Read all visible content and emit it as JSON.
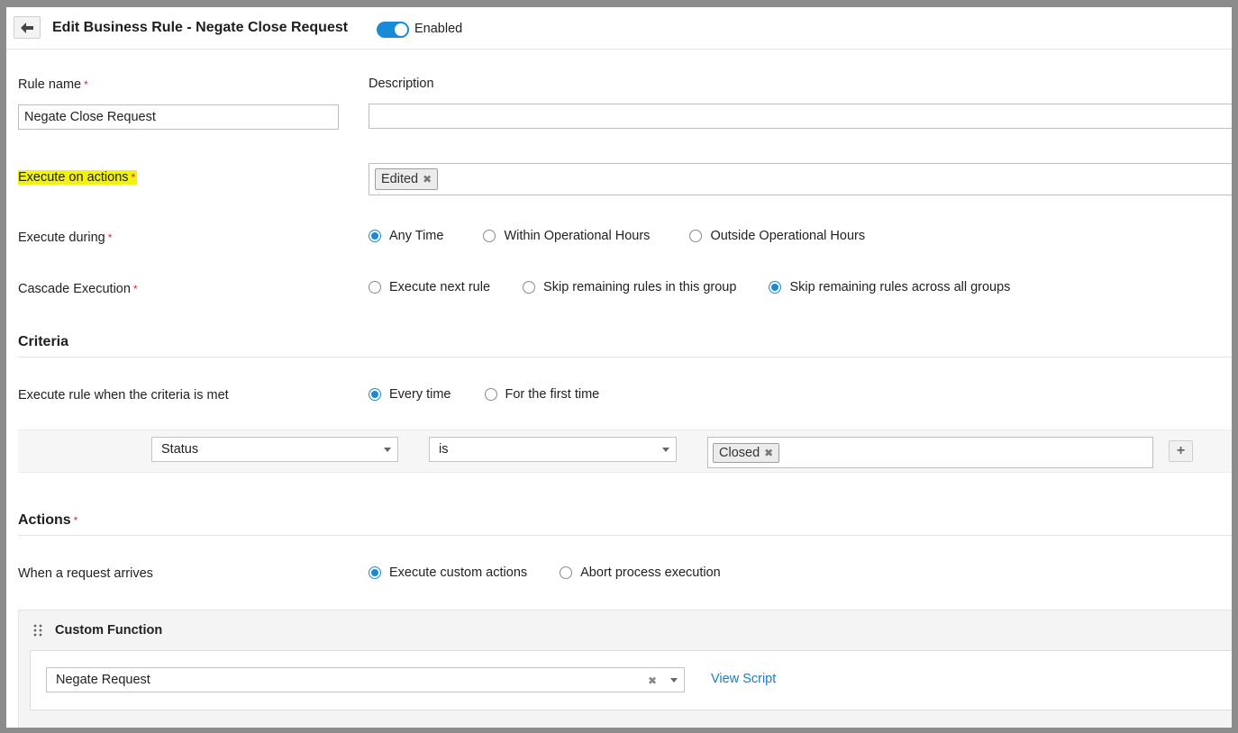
{
  "header": {
    "title": "Edit Business Rule - Negate Close Request",
    "enabled_label": "Enabled",
    "enabled": true
  },
  "form": {
    "rule_name": {
      "label": "Rule name",
      "required_mark": "*",
      "value": "Negate Close Request"
    },
    "description": {
      "label": "Description",
      "value": ""
    },
    "execute_on_actions": {
      "label": "Execute on actions",
      "required_mark": "*",
      "chips": [
        "Edited"
      ]
    },
    "execute_during": {
      "label": "Execute during",
      "required_mark": "*",
      "options": [
        "Any Time",
        "Within Operational Hours",
        "Outside Operational Hours"
      ],
      "selected": "Any Time"
    },
    "cascade_execution": {
      "label": "Cascade Execution",
      "required_mark": "*",
      "options": [
        "Execute next rule",
        "Skip remaining rules in this group",
        "Skip remaining rules across all groups"
      ],
      "selected": "Skip remaining rules across all groups"
    }
  },
  "criteria": {
    "title": "Criteria",
    "when": {
      "label": "Execute rule when the criteria is met",
      "options": [
        "Every time",
        "For the first time"
      ],
      "selected": "Every time"
    },
    "condition": {
      "field": "Status",
      "operator": "is",
      "values": [
        "Closed"
      ]
    },
    "add_symbol": "+"
  },
  "actions": {
    "title": "Actions",
    "required_mark": "*",
    "when_request": {
      "label": "When a request arrives",
      "options": [
        "Execute custom actions",
        "Abort process execution"
      ],
      "selected": "Execute custom actions"
    },
    "custom_function": {
      "title": "Custom Function",
      "function": "Negate Request",
      "view_script_label": "View Script"
    }
  },
  "icons": {
    "back": "arrow-left-icon",
    "drag": "drag-handle-icon",
    "remove": "close-icon",
    "dropdown": "chevron-down-icon"
  },
  "colors": {
    "accent": "#1a8ad6",
    "highlight": "#f2f20f",
    "required": "#d6272e",
    "link": "#1a7cc4"
  }
}
